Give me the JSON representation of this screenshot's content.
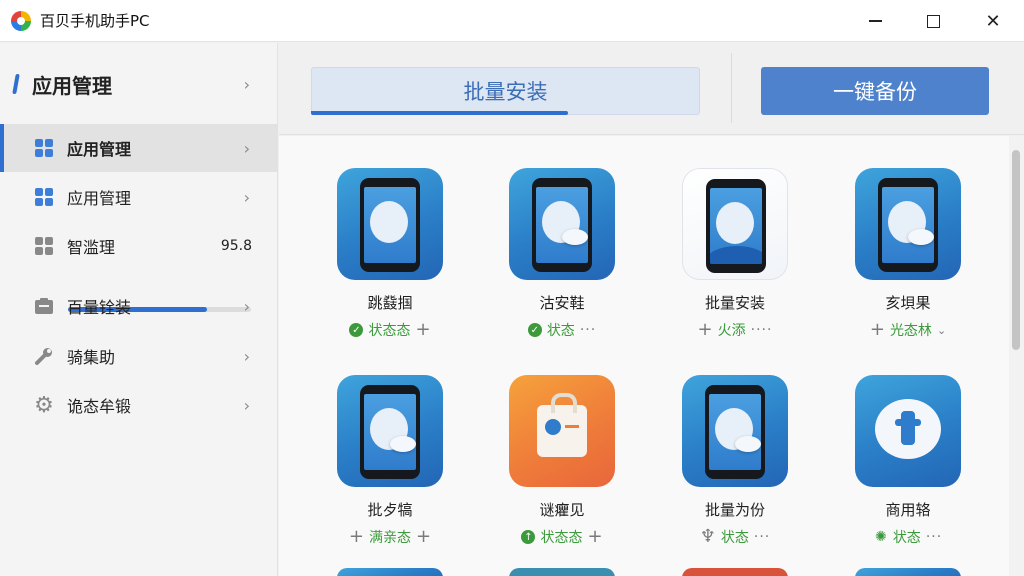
{
  "window": {
    "title": "百贝手机助手PC"
  },
  "sidebar": {
    "header": "应用管理",
    "items": [
      {
        "label": "应用管理",
        "icon": "grid-icon",
        "active": true
      },
      {
        "label": "应用管理",
        "icon": "grid-icon",
        "active": false
      },
      {
        "label": "智滥理",
        "icon": "grid-gray-icon",
        "value": "95.8",
        "progress_percent": 76
      },
      {
        "label": "百量铨装",
        "icon": "package-icon"
      },
      {
        "label": "骑集助",
        "icon": "wrench-icon"
      },
      {
        "label": "诡态牟锻",
        "icon": "gear-icon"
      }
    ]
  },
  "toolbar": {
    "batch_label": "批量安装",
    "batch_progress_percent": 66,
    "backup_label": "一键备份"
  },
  "apps": [
    {
      "name": "跳鼗掴",
      "status": "状态态",
      "status_icon": "check-badge-icon",
      "action": "+"
    },
    {
      "name": "沽安鞋",
      "status": "状态",
      "status_icon": "check-badge-icon",
      "action": "···"
    },
    {
      "name": "批量安装",
      "status": "火添",
      "status_icon": "plus-icon",
      "action": "····"
    },
    {
      "name": "亥垻果",
      "status": "光态林",
      "status_icon": "plus-icon",
      "action": "⌄"
    },
    {
      "name": "批歺犒",
      "status": "满亲态",
      "status_icon": "plus-icon",
      "action": "+"
    },
    {
      "name": "谜癯见",
      "status": "状态态",
      "status_icon": "arrow-up-badge-icon",
      "action": "+"
    },
    {
      "name": "批量为份",
      "status": "状态",
      "status_icon": "tree-icon",
      "action": "···"
    },
    {
      "name": "商用辂",
      "status": "状态",
      "status_icon": "sun-icon",
      "action": "···"
    }
  ],
  "colors": {
    "accent": "#2f6fd0",
    "status_green": "#3c9a3c",
    "backup_button": "#4f82cc"
  }
}
